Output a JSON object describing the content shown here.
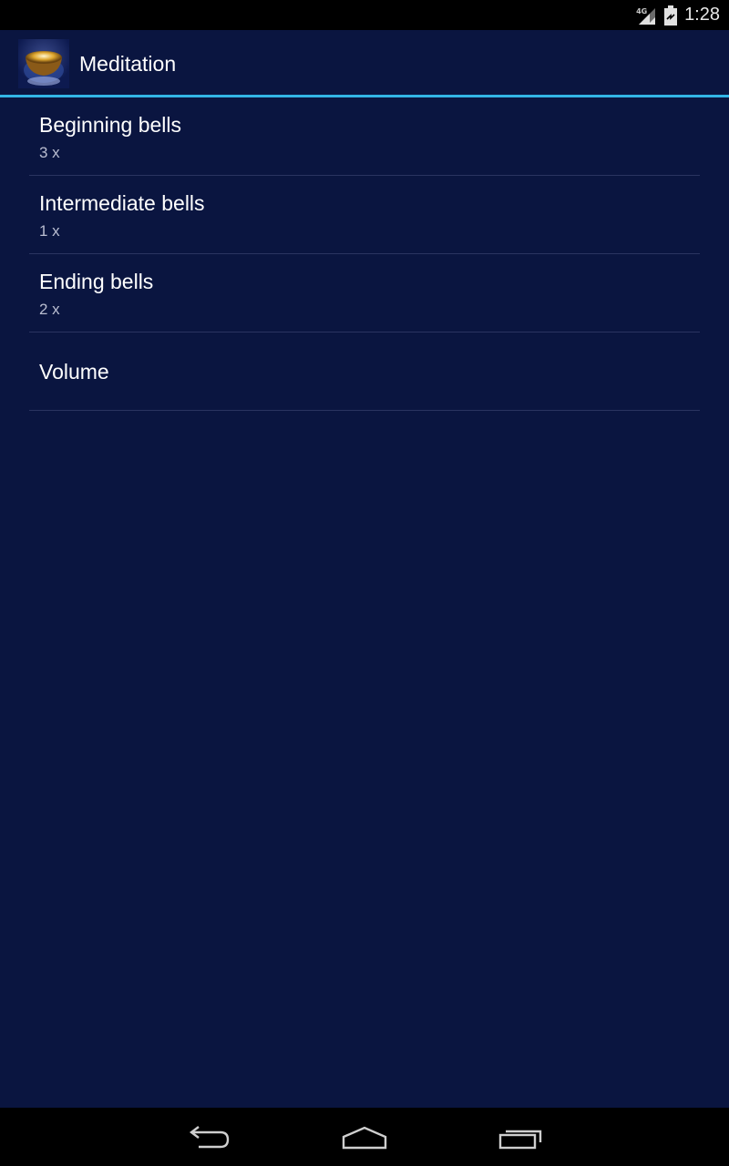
{
  "status_bar": {
    "network_label": "4G",
    "time": "1:28",
    "icons": [
      "signal-icon",
      "battery-icon"
    ]
  },
  "action_bar": {
    "title": "Meditation",
    "accent_color": "#33b5e5"
  },
  "preferences": [
    {
      "title": "Beginning bells",
      "summary": "3 x"
    },
    {
      "title": "Intermediate bells",
      "summary": "1 x"
    },
    {
      "title": "Ending bells",
      "summary": "2 x"
    },
    {
      "title": "Volume",
      "summary": ""
    }
  ],
  "nav_bar": {
    "icons": [
      "back-icon",
      "home-icon",
      "recent-apps-icon"
    ]
  },
  "colors": {
    "background": "#0a1540",
    "divider": "#2a3460"
  }
}
